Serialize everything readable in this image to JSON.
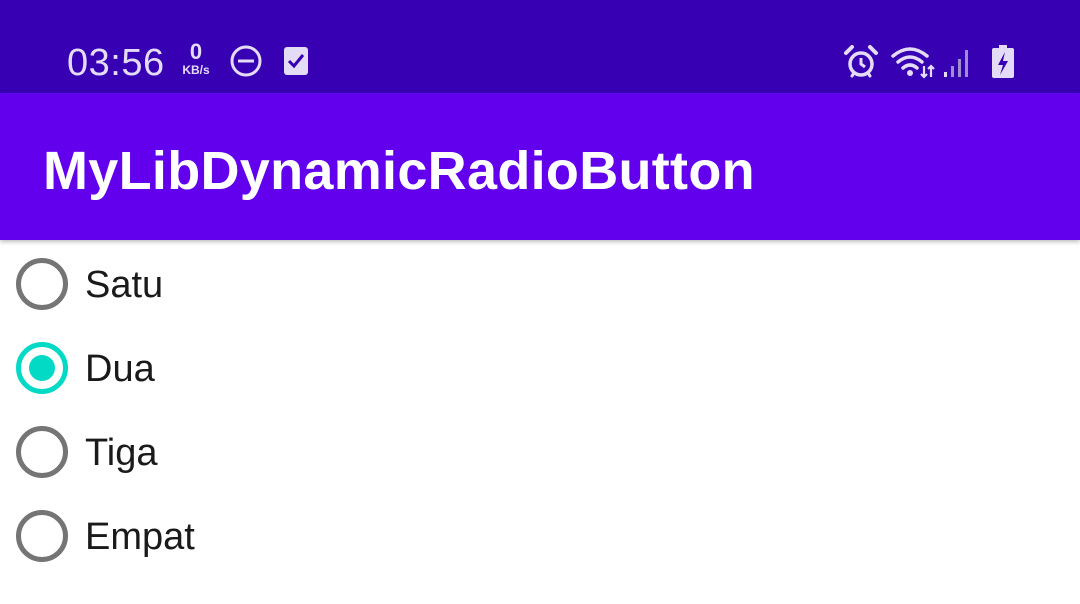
{
  "status_bar": {
    "time": "03:56",
    "net_speed_value": "0",
    "net_speed_unit": "KB/s",
    "icons": [
      "dnd-icon",
      "checklist-app-icon",
      "alarm-icon",
      "wifi-icon",
      "signal-icon",
      "battery-charging-icon"
    ]
  },
  "app_bar": {
    "title": "MyLibDynamicRadioButton"
  },
  "radio_group": {
    "options": [
      {
        "label": "Satu",
        "checked": false
      },
      {
        "label": "Dua",
        "checked": true
      },
      {
        "label": "Tiga",
        "checked": false
      },
      {
        "label": "Empat",
        "checked": false
      }
    ],
    "selected": "Dua"
  },
  "colors": {
    "status_bar": "#3700b3",
    "app_bar": "#6200ee",
    "accent": "#03dac5",
    "radio_unchecked": "#757575"
  }
}
